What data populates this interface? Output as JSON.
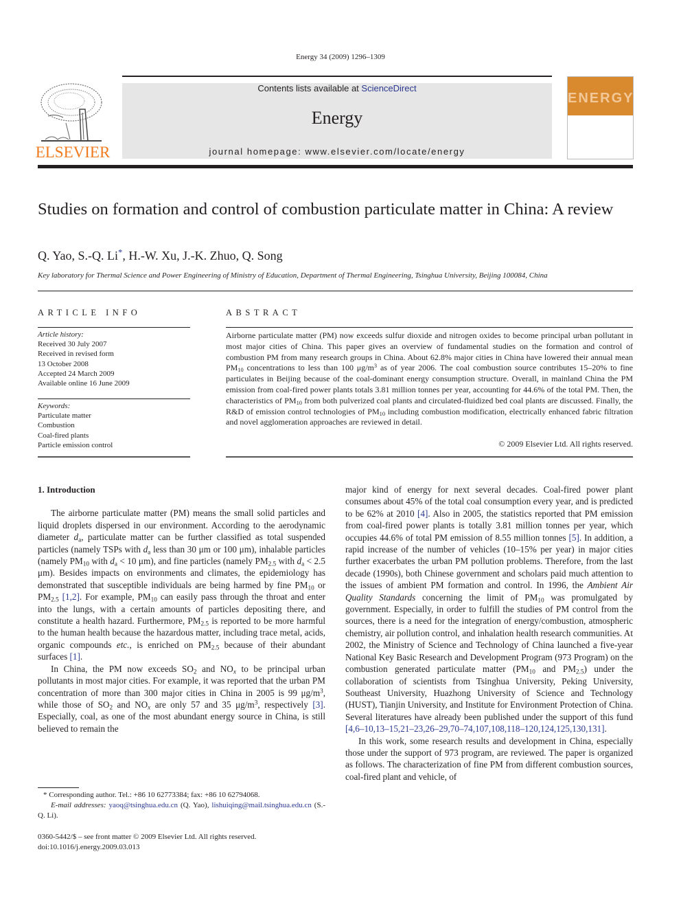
{
  "header": {
    "citation": "Energy 34 (2009) 1296–1309",
    "contents_prefix": "Contents lists available at ",
    "sciencedirect": "ScienceDirect",
    "journal_name": "Energy",
    "homepage": "journal homepage: www.elsevier.com/locate/energy",
    "publisher_logo_text": "ELSEVIER",
    "cover_word": "ENERGY",
    "brand_color": "#f07b1f",
    "cover_color": "#d98a2e"
  },
  "article": {
    "title": "Studies on formation and control of combustion particulate matter in China: A review",
    "authors": "Q. Yao, S.-Q. Li",
    "authors_rest": ", H.-W. Xu, J.-K. Zhuo, Q. Song",
    "corresponding_mark": "*",
    "affiliation": "Key laboratory for Thermal Science and Power Engineering of Ministry of Education, Department of Thermal Engineering, Tsinghua University, Beijing 100084, China"
  },
  "article_info": {
    "label": "ARTICLE INFO",
    "history_label": "Article history:",
    "history": [
      "Received 30 July 2007",
      "Received in revised form",
      "13 October 2008",
      "Accepted 24 March 2009",
      "Available online 16 June 2009"
    ],
    "keywords_label": "Keywords:",
    "keywords": [
      "Particulate matter",
      "Combustion",
      "Coal-fired plants",
      "Particle emission control"
    ]
  },
  "abstract": {
    "label": "ABSTRACT",
    "copyright": "© 2009 Elsevier Ltd. All rights reserved."
  },
  "intro": {
    "heading": "1.  Introduction"
  },
  "footnote": {
    "corresponding": "* Corresponding author. Tel.: +86 10 62773384; fax: +86 10 62794068.",
    "email_label": "E-mail addresses:",
    "email1": "yaoq@tsinghua.edu.cn",
    "email1_owner": " (Q. Yao), ",
    "email2": "lishuiqing@mail.tsinghua.edu.cn",
    "email2_owner": " (S.-Q. Li).",
    "issn": "0360-5442/$ – see front matter © 2009 Elsevier Ltd. All rights reserved.",
    "doi": "doi:10.1016/j.energy.2009.03.013"
  }
}
